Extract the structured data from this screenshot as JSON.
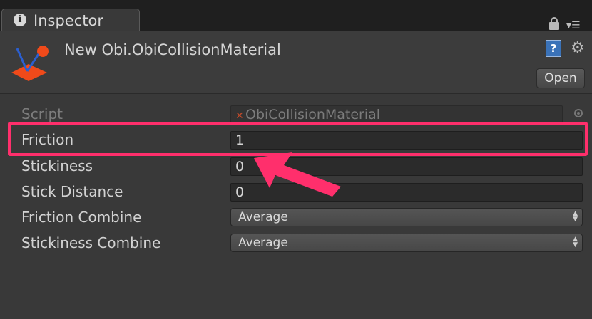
{
  "tab": {
    "title": "Inspector",
    "icon": "info-icon"
  },
  "header": {
    "asset_title": "New Obi.ObiCollisionMaterial",
    "open_label": "Open",
    "help_glyph": "?"
  },
  "properties": {
    "script": {
      "label": "Script",
      "value": "ObiCollisionMaterial"
    },
    "friction": {
      "label": "Friction",
      "value": "1"
    },
    "stickiness": {
      "label": "Stickiness",
      "value": "0"
    },
    "stick_distance": {
      "label": "Stick Distance",
      "value": "0"
    },
    "friction_combine": {
      "label": "Friction Combine",
      "value": "Average"
    },
    "stickiness_combine": {
      "label": "Stickiness Combine",
      "value": "Average"
    }
  },
  "colors": {
    "highlight": "#ff2f6c",
    "logo_orange": "#f04a1a",
    "logo_blue": "#2b5fd0",
    "background": "#393939"
  }
}
